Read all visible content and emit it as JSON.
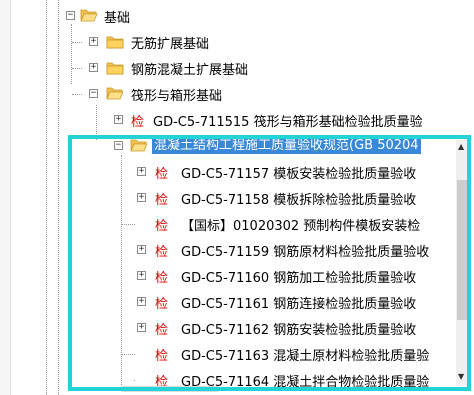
{
  "tree": {
    "root": {
      "label": "基础"
    },
    "children": [
      {
        "label": "无筋扩展基础"
      },
      {
        "label": "钢筋混凝土扩展基础"
      },
      {
        "label": "筏形与箱形基础"
      }
    ],
    "raft_item": {
      "badge": "检",
      "label": "GD-C5-711515 筏形与箱形基础检验批质量验"
    },
    "selected_folder": {
      "label": "混凝土结构工程施工质量验收规范(GB 50204"
    },
    "items": [
      {
        "badge": "检",
        "label": "GD-C5-71157 模板安装检验批质量验收"
      },
      {
        "badge": "检",
        "label": "GD-C5-71158 模板拆除检验批质量验收"
      },
      {
        "badge": "检",
        "label": "【国标】01020302 预制构件模板安装检"
      },
      {
        "badge": "检",
        "label": "GD-C5-71159 钢筋原材料检验批质量验收"
      },
      {
        "badge": "检",
        "label": "GD-C5-71160 钢筋加工检验批质量验收"
      },
      {
        "badge": "检",
        "label": "GD-C5-71161 钢筋连接检验批质量验收"
      },
      {
        "badge": "检",
        "label": "GD-C5-71162 钢筋安装检验批质量验收"
      },
      {
        "badge": "检",
        "label": "GD-C5-71163 混凝土原材料检验批质量验"
      },
      {
        "badge": "检",
        "label": "GD-C5-71164 混凝土拌合物检验批质量验"
      }
    ]
  },
  "colors": {
    "highlight_border": "#22d3d8",
    "selection": "#3a88d8",
    "badge": "#e00000",
    "folder": "#f2c14e"
  }
}
